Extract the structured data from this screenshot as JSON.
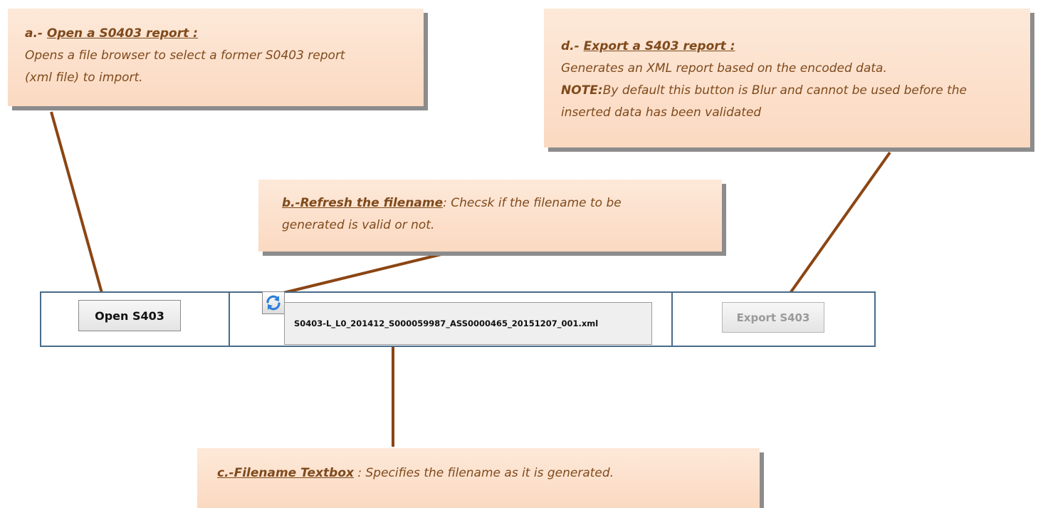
{
  "callouts": {
    "a": {
      "prefix": "a.- ",
      "title": "Open a S0403 report :",
      "lines": [
        "Opens a file browser to select a former S0403 report",
        "(xml file) to import."
      ]
    },
    "b": {
      "title": "b.-Refresh the filename",
      "rest": ": Checsk if the filename to be",
      "line2": "generated is valid or not."
    },
    "c": {
      "title": "c.-Filename Textbox",
      "rest": " : Specifies the filename as it is generated."
    },
    "d": {
      "prefix": "d.- ",
      "title": "Export a S403 report :",
      "line1": "Generates an XML report based on the encoded data.",
      "note_label": "NOTE:",
      "note_text": "By default this button is Blur and cannot be used before the",
      "line3": "inserted data has been validated"
    }
  },
  "toolbar": {
    "open_label": "Open S403",
    "filename": "S0403-L_L0_201412_S000059987_ASS0000465_20151207_001.xml",
    "export_label": "Export S403",
    "export_enabled": false,
    "refresh_icon": "refresh-icon"
  },
  "colors": {
    "callout_bg": "#fde9d9",
    "callout_text": "#7f4a1c",
    "leader_line": "#8b4513",
    "bar_border": "#4a6a8a",
    "refresh_blue": "#2f7fd8"
  }
}
